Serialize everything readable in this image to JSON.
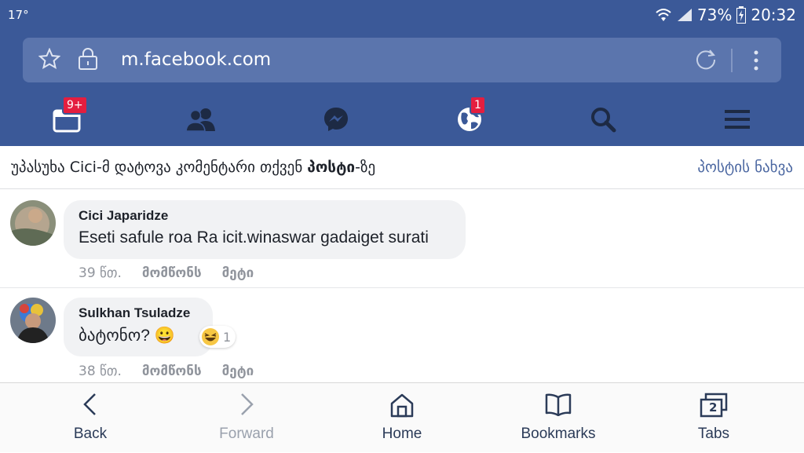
{
  "status_bar": {
    "temperature": "17°",
    "battery": "73%",
    "time": "20:32"
  },
  "browser": {
    "url": "m.facebook.com"
  },
  "fb_nav": {
    "items": [
      {
        "name": "friend-requests",
        "icon": "news-feed-icon",
        "badge": "9+"
      },
      {
        "name": "friends",
        "icon": "friends-icon",
        "badge": ""
      },
      {
        "name": "messenger",
        "icon": "messenger-icon",
        "badge": ""
      },
      {
        "name": "notifications",
        "icon": "globe-icon",
        "badge": "1"
      },
      {
        "name": "search",
        "icon": "search-icon",
        "badge": ""
      },
      {
        "name": "menu",
        "icon": "menu-icon",
        "badge": ""
      }
    ]
  },
  "notification": {
    "prefix": "უპასუხა Cici-მ დატოვა კომენტარი თქვენ ",
    "bold": "პოსტი",
    "suffix": "-ზე",
    "view_post": "პოსტის ნახვა"
  },
  "comments": [
    {
      "author": "Cici Japaridze",
      "text": "Eseti safule roa Ra icit.winaswar gadaiget surati",
      "time": "39 წთ.",
      "like": "მომწონს",
      "more": "მეტი"
    },
    {
      "author": "Sulkhan Tsuladze",
      "text": "ბატონო? 😀",
      "time": "38 წთ.",
      "like": "მომწონს",
      "more": "მეტი",
      "reaction_count": "1"
    }
  ],
  "bottom_bar": {
    "back": "Back",
    "forward": "Forward",
    "home": "Home",
    "bookmarks": "Bookmarks",
    "tabs": "Tabs",
    "tab_count": "2"
  },
  "colors": {
    "facebook_blue": "#3b5998",
    "badge_red": "#e41e3f",
    "link_blue": "#4b67a1"
  }
}
